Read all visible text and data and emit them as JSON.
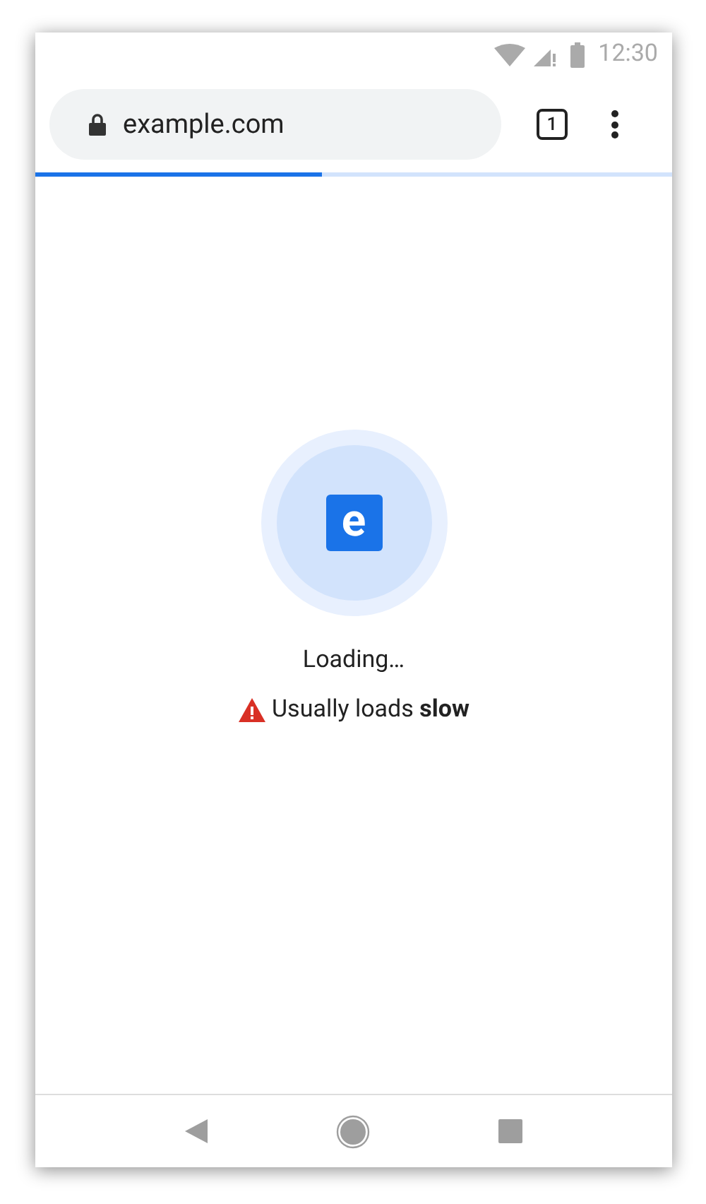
{
  "status_bar": {
    "time": "12:30"
  },
  "toolbar": {
    "url": "example.com",
    "secure": true,
    "tab_count": "1"
  },
  "progress": {
    "level": 0.45
  },
  "loading": {
    "favicon_letter": "e",
    "message": "Loading…",
    "warning": "Usually loads **slow**"
  }
}
